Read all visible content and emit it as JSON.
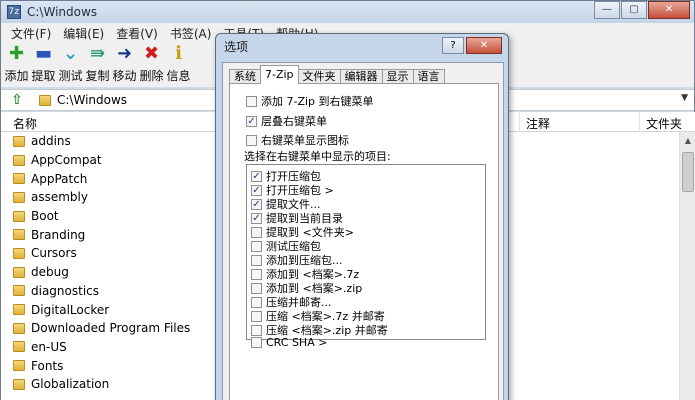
{
  "window": {
    "title": "C:\\Windows",
    "icon_text": "7z",
    "controls": {
      "minimize": "—",
      "maximize": "▢",
      "close": "✕"
    }
  },
  "menu": [
    "文件(F)",
    "编辑(E)",
    "查看(V)",
    "书签(A)",
    "工具(T)",
    "帮助(H)"
  ],
  "toolbar": [
    {
      "label": "添加",
      "icon": "plus-icon",
      "glyph": "✚",
      "color": "#2e9e2e"
    },
    {
      "label": "提取",
      "icon": "minus-icon",
      "glyph": "▬",
      "color": "#2a55b8"
    },
    {
      "label": "测试",
      "icon": "check-chevron-icon",
      "glyph": "⌄",
      "color": "#22a4b8"
    },
    {
      "label": "复制",
      "icon": "double-arrow-icon",
      "glyph": "⇛",
      "color": "#2a9a72"
    },
    {
      "label": "移动",
      "icon": "arrow-right-icon",
      "glyph": "➜",
      "color": "#1c3a8a"
    },
    {
      "label": "删除",
      "icon": "delete-x-icon",
      "glyph": "✖",
      "color": "#cc2020"
    },
    {
      "label": "信息",
      "icon": "info-icon",
      "glyph": "ℹ",
      "color": "#c99a12"
    }
  ],
  "address": {
    "path": "C:\\Windows",
    "dropdown": "▼",
    "up_glyph": "⇧"
  },
  "list": {
    "columns": {
      "name": "名称",
      "note": "注释",
      "folder": "文件夹"
    },
    "rows": [
      "addins",
      "AppCompat",
      "AppPatch",
      "assembly",
      "Boot",
      "Branding",
      "Cursors",
      "debug",
      "diagnostics",
      "DigitalLocker",
      "Downloaded Program Files",
      "en-US",
      "Fonts",
      "Globalization"
    ]
  },
  "dialog": {
    "title": "选项",
    "controls": {
      "help": "?",
      "close": "✕"
    },
    "tabs": [
      "系统",
      "7-Zip",
      "文件夹",
      "编辑器",
      "显示",
      "语言"
    ],
    "active_tab": "7-Zip",
    "options": [
      {
        "label": "添加 7-Zip 到右键菜单",
        "checked": false
      },
      {
        "label": "层叠右键菜单",
        "checked": true
      },
      {
        "label": "右键菜单显示图标",
        "checked": false
      }
    ],
    "section_label": "选择在右键菜单中显示的项目:",
    "items": [
      {
        "label": "打开压缩包",
        "checked": true
      },
      {
        "label": "打开压缩包 >",
        "checked": true
      },
      {
        "label": "提取文件...",
        "checked": true
      },
      {
        "label": "提取到当前目录",
        "checked": true
      },
      {
        "label": "提取到 <文件夹>",
        "checked": false
      },
      {
        "label": "测试压缩包",
        "checked": false
      },
      {
        "label": "添加到压缩包...",
        "checked": false
      },
      {
        "label": "添加到 <档案>.7z",
        "checked": false
      },
      {
        "label": "添加到 <档案>.zip",
        "checked": false
      },
      {
        "label": "压缩并邮寄...",
        "checked": false
      },
      {
        "label": "压缩 <档案>.7z 并邮寄",
        "checked": false
      },
      {
        "label": "压缩 <档案>.zip 并邮寄",
        "checked": false
      },
      {
        "label": "CRC SHA >",
        "checked": false
      }
    ]
  }
}
